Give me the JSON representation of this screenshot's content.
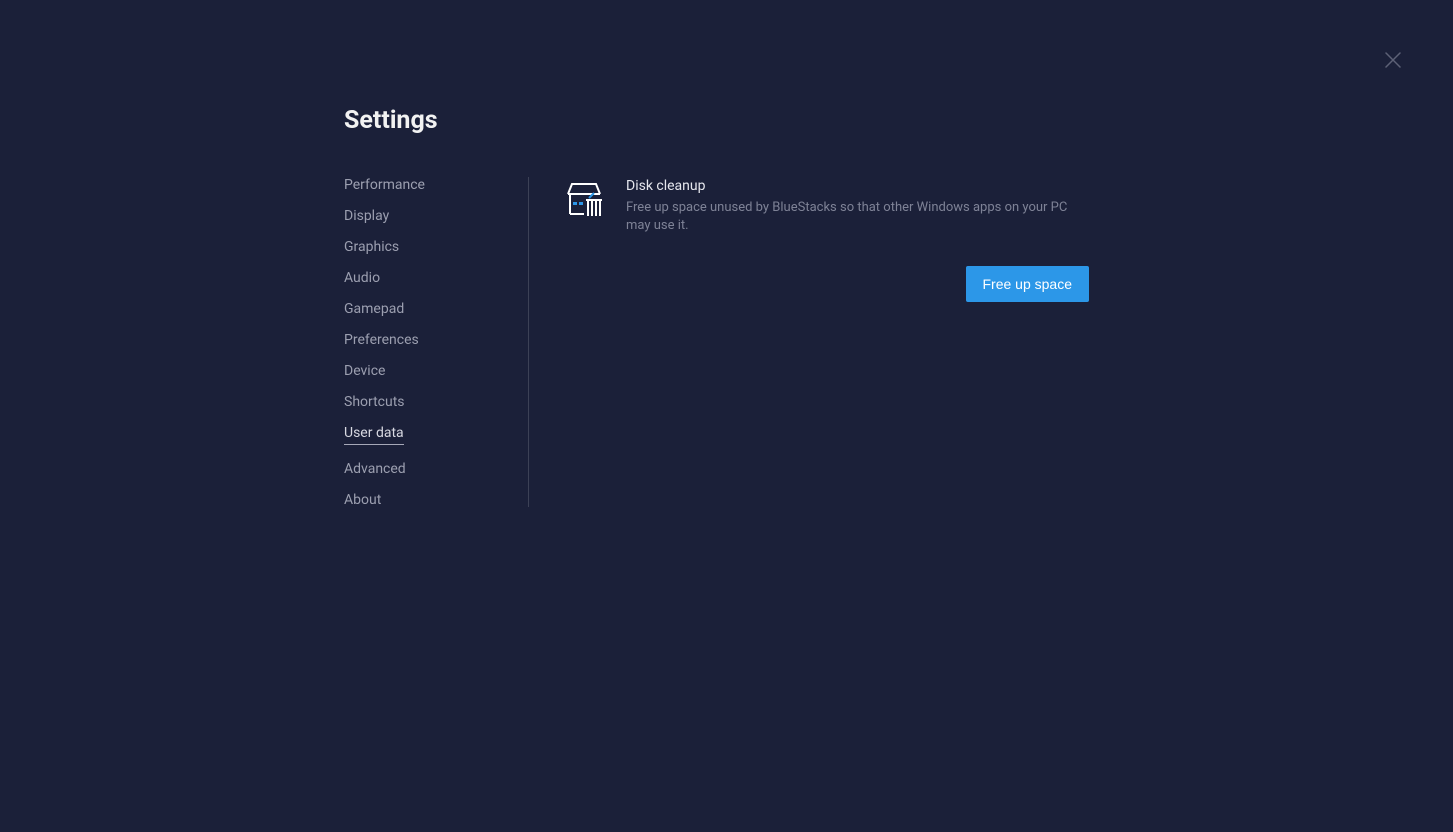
{
  "header": {
    "title": "Settings"
  },
  "sidebar": {
    "items": [
      {
        "label": "Performance",
        "id": "performance"
      },
      {
        "label": "Display",
        "id": "display"
      },
      {
        "label": "Graphics",
        "id": "graphics"
      },
      {
        "label": "Audio",
        "id": "audio"
      },
      {
        "label": "Gamepad",
        "id": "gamepad"
      },
      {
        "label": "Preferences",
        "id": "preferences"
      },
      {
        "label": "Device",
        "id": "device"
      },
      {
        "label": "Shortcuts",
        "id": "shortcuts"
      },
      {
        "label": "User data",
        "id": "user-data"
      },
      {
        "label": "Advanced",
        "id": "advanced"
      },
      {
        "label": "About",
        "id": "about"
      }
    ],
    "active_index": 8
  },
  "content": {
    "disk_cleanup": {
      "title": "Disk cleanup",
      "description": "Free up space unused by BlueStacks so that other Windows apps on your PC may use it.",
      "button_label": "Free up space"
    }
  }
}
